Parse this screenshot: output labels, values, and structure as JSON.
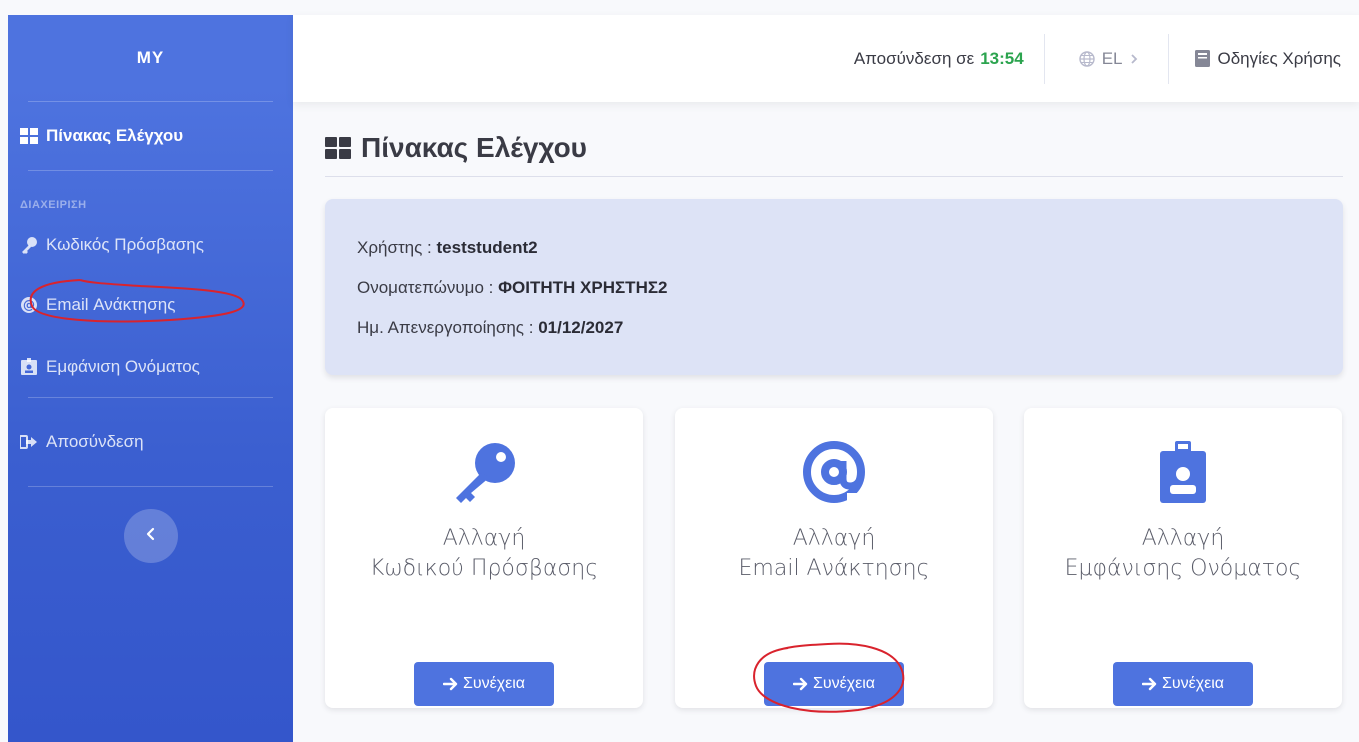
{
  "sidebar": {
    "brand": "MY",
    "dashboard_label": "Πίνακας Ελέγχου",
    "section_heading": "ΔΙΑΧΕΙΡΙΣΗ",
    "items": [
      {
        "label": "Κωδικός Πρόσβασης",
        "icon": "key-icon"
      },
      {
        "label": "Email Ανάκτησης",
        "icon": "at-icon"
      },
      {
        "label": "Εμφάνιση Ονόματος",
        "icon": "id-badge-icon"
      }
    ],
    "logout_label": "Αποσύνδεση",
    "toggle_icon": "chevron-left-icon"
  },
  "topbar": {
    "logout_prefix": "Αποσύνδεση σε",
    "logout_timer": "13:54",
    "language": "EL",
    "manual_label": "Οδηγίες Χρήσης"
  },
  "page": {
    "title": "Πίνακας Ελέγχου"
  },
  "user_info": {
    "username_label": "Χρήστης : ",
    "username": "teststudent2",
    "fullname_label": "Ονοματεπώνυμο : ",
    "fullname": "ΦΟΙΤΗΤΗ ΧΡΗΣΤΗΣ2",
    "expiry_label": "Ημ. Απενεργοποίησης : ",
    "expiry": "01/12/2027"
  },
  "cards": [
    {
      "line1": "Αλλαγή",
      "line2": "Κωδικού Πρόσβασης",
      "button": "Συνέχεια",
      "icon": "key-icon"
    },
    {
      "line1": "Αλλαγή",
      "line2": "Email Ανάκτησης",
      "button": "Συνέχεια",
      "icon": "at-icon"
    },
    {
      "line1": "Αλλαγή",
      "line2": "Εμφάνισης Ονόματος",
      "button": "Συνέχεια",
      "icon": "id-badge-icon"
    }
  ],
  "colors": {
    "primary": "#4e73df",
    "timer": "#2ca44f",
    "annotation": "#d9232d"
  }
}
